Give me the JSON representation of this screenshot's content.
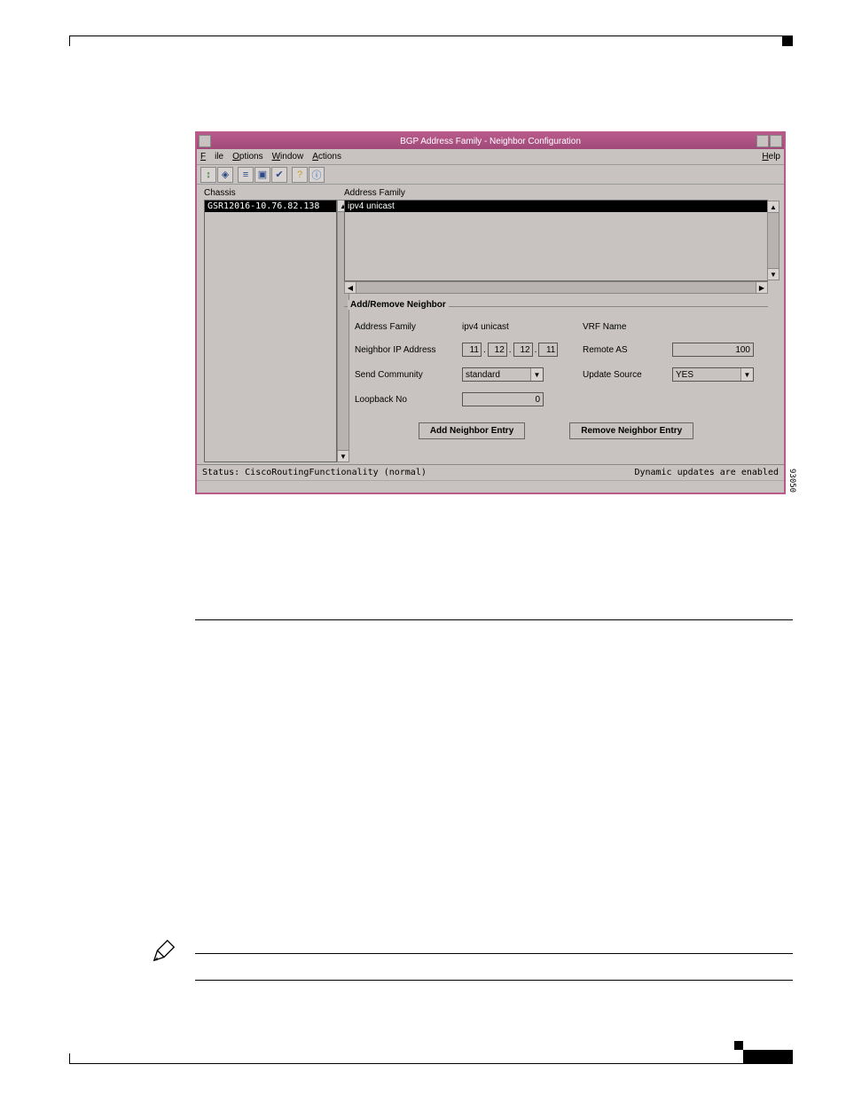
{
  "window": {
    "title": "BGP Address Family - Neighbor Configuration",
    "menus": {
      "file": "File",
      "options": "Options",
      "window": "Window",
      "actions": "Actions",
      "help": "Help"
    }
  },
  "panels": {
    "chassis_label": "Chassis",
    "chassis_selected": "GSR12016-10.76.82.138",
    "af_label": "Address Family",
    "af_selected": "ipv4 unicast"
  },
  "group": {
    "title": "Add/Remove Neighbor",
    "fields": {
      "address_family_label": "Address Family",
      "address_family_value": "ipv4 unicast",
      "vrf_name_label": "VRF Name",
      "vrf_name_value": "",
      "neighbor_ip_label": "Neighbor IP Address",
      "ip": {
        "a": "11",
        "b": "12",
        "c": "12",
        "d": "11"
      },
      "remote_as_label": "Remote AS",
      "remote_as_value": "100",
      "send_community_label": "Send Community",
      "send_community_value": "standard",
      "update_source_label": "Update Source",
      "update_source_value": "YES",
      "loopback_no_label": "Loopback No",
      "loopback_no_value": "0"
    },
    "buttons": {
      "add": "Add Neighbor Entry",
      "remove": "Remove Neighbor Entry"
    }
  },
  "status": {
    "left": "Status: CiscoRoutingFunctionality (normal)",
    "right": "Dynamic updates are enabled"
  },
  "fig_id": "93050"
}
